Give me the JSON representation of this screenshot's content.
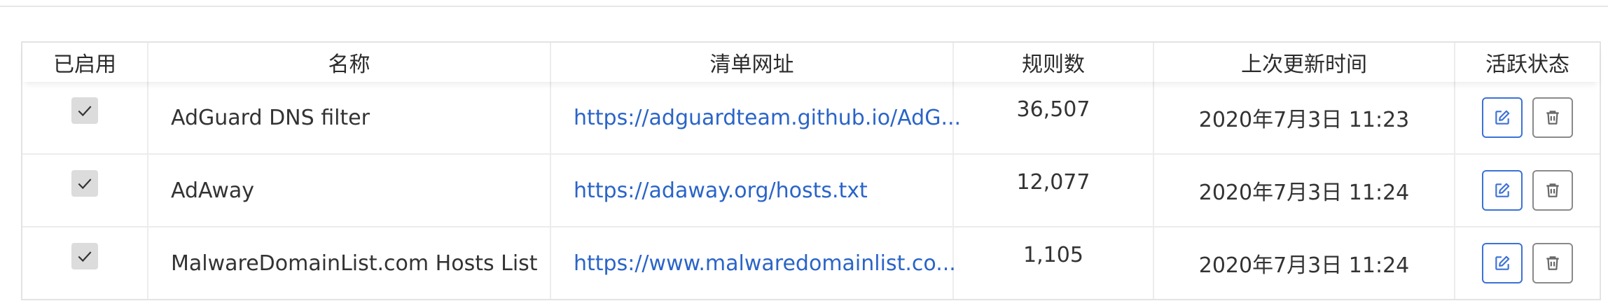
{
  "table": {
    "headers": {
      "enabled": "已启用",
      "name": "名称",
      "url": "清单网址",
      "rules": "规则数",
      "updated": "上次更新时间",
      "actions": "活跃状态"
    },
    "rows": [
      {
        "enabled": true,
        "name": "AdGuard DNS filter",
        "url": "https://adguardteam.github.io/AdG...",
        "rules": "36,507",
        "updated": "2020年7月3日 11:23"
      },
      {
        "enabled": true,
        "name": "AdAway",
        "url": "https://adaway.org/hosts.txt",
        "rules": "12,077",
        "updated": "2020年7月3日 11:24"
      },
      {
        "enabled": true,
        "name": "MalwareDomainList.com Hosts List",
        "url": "https://www.malwaredomainlist.co...",
        "rules": "1,105",
        "updated": "2020年7月3日 11:24"
      }
    ]
  },
  "icons": {
    "checkbox": "check-icon",
    "edit": "edit-icon",
    "delete": "trash-icon"
  },
  "colors": {
    "link": "#2a64c8",
    "edit_border": "#3c72d6",
    "delete_border": "#8a8a8a",
    "checkbox_bg": "#dcdcdc"
  }
}
